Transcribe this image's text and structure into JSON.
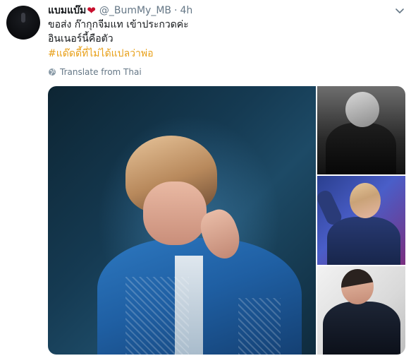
{
  "tweet": {
    "author": {
      "display_name": "แบมแบ๊ม",
      "heart_glyph": "❤",
      "handle": "@_BumMy_MB",
      "separator": "·",
      "time": "4h"
    },
    "text": {
      "line1": "ขอส่ง ก๊ากุกจีมแท เข้าประกวดค่ะ",
      "line2": "อินเนอร์นี้คือตัว",
      "hashtag": "#แด๊ดดี้ที่ไม่ได้แปลว่าพ่อ"
    },
    "translate_label": "Translate from Thai",
    "colors": {
      "hashtag": "#e8a019",
      "heart": "#c8102e",
      "muted": "#657786"
    },
    "icons": {
      "menu": "chevron-down-icon",
      "translate": "globe-icon"
    },
    "media": {
      "count": 4,
      "layout": "one large photo on the left, three stacked thumbnails on the right"
    }
  }
}
